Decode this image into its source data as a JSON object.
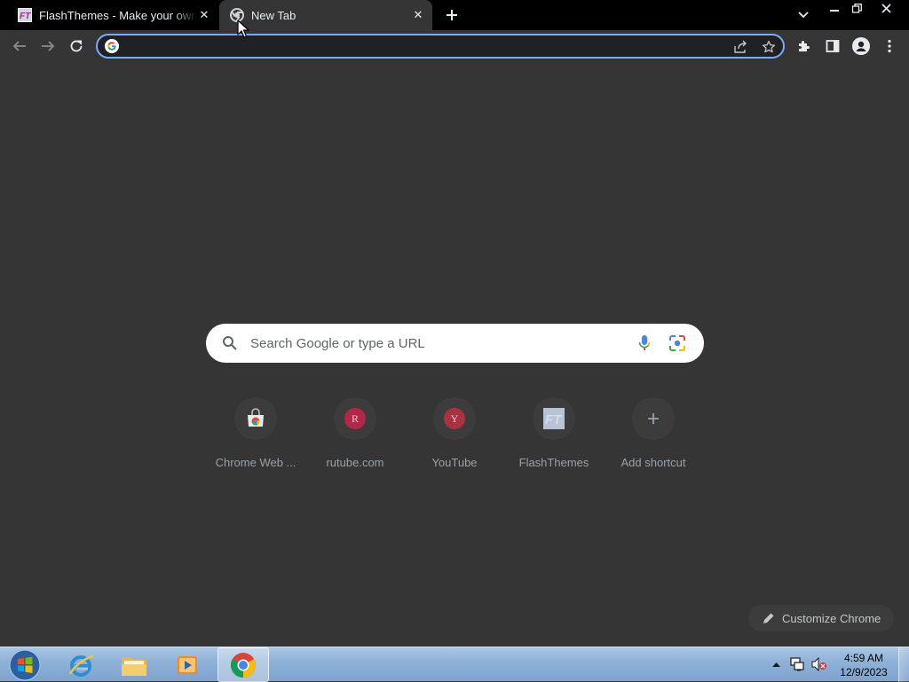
{
  "tabs": [
    {
      "title": "FlashThemes - Make your own cartoons!",
      "favicon": "flashthemes-favicon"
    },
    {
      "title": "New Tab",
      "favicon": "chrome-favicon"
    }
  ],
  "omnibox": {
    "value": "",
    "placeholder": ""
  },
  "search": {
    "placeholder": "Search Google or type a URL"
  },
  "shortcuts": [
    {
      "label": "Chrome Web ...",
      "icon": "chrome-web-store-icon",
      "letter": ""
    },
    {
      "label": "rutube.com",
      "icon": "letter-r",
      "letter": "R",
      "color": "#b3264a"
    },
    {
      "label": "YouTube",
      "icon": "letter-y",
      "letter": "Y",
      "color": "#a8323f"
    },
    {
      "label": "FlashThemes",
      "icon": "flashthemes-icon",
      "letter": ""
    },
    {
      "label": "Add shortcut",
      "icon": "plus-icon",
      "letter": ""
    }
  ],
  "customize": {
    "label": "Customize Chrome"
  },
  "clock": {
    "time": "4:59 AM",
    "date": "12/9/2023"
  },
  "colors": {
    "tabstrip": "#000000",
    "toolbar": "#353535",
    "focus_ring": "#7cacf8",
    "ntp_bg": "#353535"
  }
}
